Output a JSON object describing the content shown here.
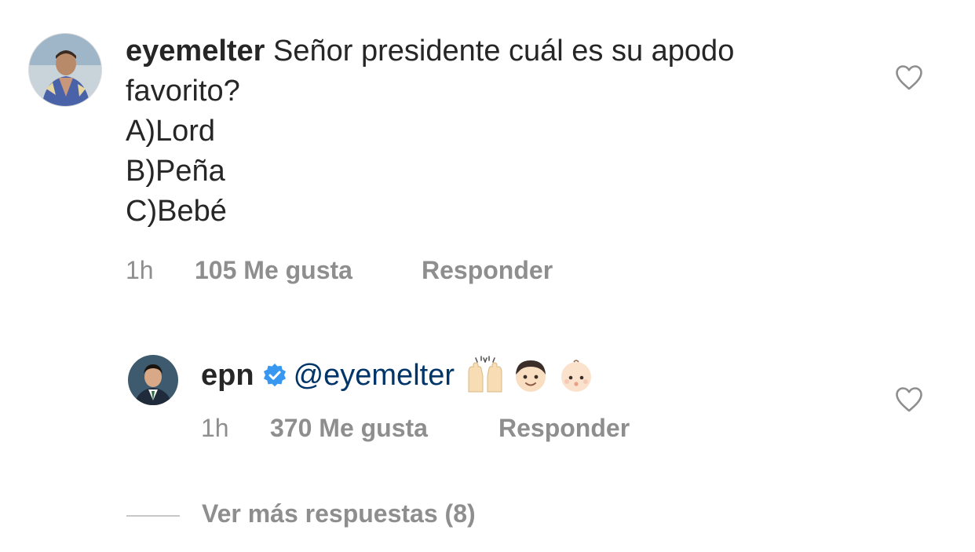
{
  "comment": {
    "username": "eyemelter",
    "text_line1": "Señor presidente cuál es su apodo",
    "text_line2": "favorito?",
    "options": [
      "A)Lord",
      "B)Peña",
      "C)Bebé"
    ],
    "time": "1h",
    "likes": "105 Me gusta",
    "reply_label": "Responder",
    "like_icon": "heart-outline-icon"
  },
  "reply": {
    "username": "epn",
    "verified": true,
    "verified_color": "#3897f0",
    "mention": "@eyemelter",
    "emojis": [
      "raising-hands-emoji",
      "boy-emoji",
      "baby-emoji"
    ],
    "time": "1h",
    "likes": "370 Me gusta",
    "reply_label": "Responder",
    "like_icon": "heart-outline-icon"
  },
  "view_more": {
    "label": "Ver más respuestas (8)"
  },
  "colors": {
    "text": "#262626",
    "secondary": "#8e8e8e",
    "mention": "#003569",
    "divider": "#c7c7c7"
  }
}
